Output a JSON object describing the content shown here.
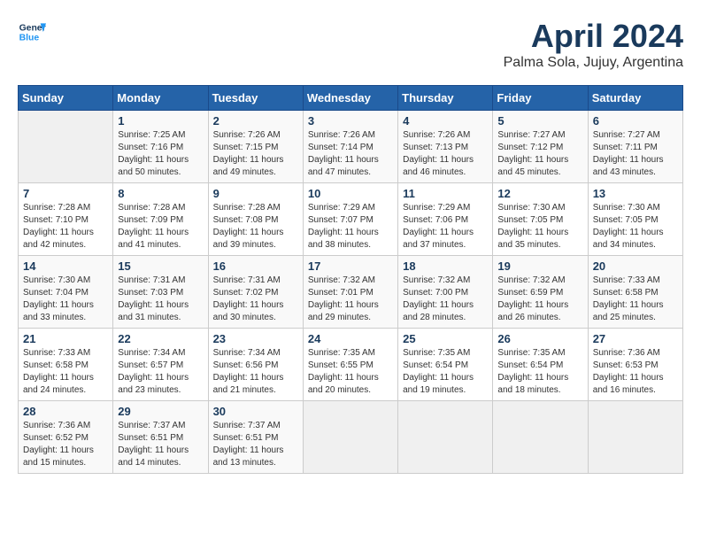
{
  "header": {
    "logo_line1": "General",
    "logo_line2": "Blue",
    "month": "April 2024",
    "location": "Palma Sola, Jujuy, Argentina"
  },
  "days_of_week": [
    "Sunday",
    "Monday",
    "Tuesday",
    "Wednesday",
    "Thursday",
    "Friday",
    "Saturday"
  ],
  "weeks": [
    [
      {
        "day": "",
        "info": ""
      },
      {
        "day": "1",
        "info": "Sunrise: 7:25 AM\nSunset: 7:16 PM\nDaylight: 11 hours\nand 50 minutes."
      },
      {
        "day": "2",
        "info": "Sunrise: 7:26 AM\nSunset: 7:15 PM\nDaylight: 11 hours\nand 49 minutes."
      },
      {
        "day": "3",
        "info": "Sunrise: 7:26 AM\nSunset: 7:14 PM\nDaylight: 11 hours\nand 47 minutes."
      },
      {
        "day": "4",
        "info": "Sunrise: 7:26 AM\nSunset: 7:13 PM\nDaylight: 11 hours\nand 46 minutes."
      },
      {
        "day": "5",
        "info": "Sunrise: 7:27 AM\nSunset: 7:12 PM\nDaylight: 11 hours\nand 45 minutes."
      },
      {
        "day": "6",
        "info": "Sunrise: 7:27 AM\nSunset: 7:11 PM\nDaylight: 11 hours\nand 43 minutes."
      }
    ],
    [
      {
        "day": "7",
        "info": "Sunrise: 7:28 AM\nSunset: 7:10 PM\nDaylight: 11 hours\nand 42 minutes."
      },
      {
        "day": "8",
        "info": "Sunrise: 7:28 AM\nSunset: 7:09 PM\nDaylight: 11 hours\nand 41 minutes."
      },
      {
        "day": "9",
        "info": "Sunrise: 7:28 AM\nSunset: 7:08 PM\nDaylight: 11 hours\nand 39 minutes."
      },
      {
        "day": "10",
        "info": "Sunrise: 7:29 AM\nSunset: 7:07 PM\nDaylight: 11 hours\nand 38 minutes."
      },
      {
        "day": "11",
        "info": "Sunrise: 7:29 AM\nSunset: 7:06 PM\nDaylight: 11 hours\nand 37 minutes."
      },
      {
        "day": "12",
        "info": "Sunrise: 7:30 AM\nSunset: 7:05 PM\nDaylight: 11 hours\nand 35 minutes."
      },
      {
        "day": "13",
        "info": "Sunrise: 7:30 AM\nSunset: 7:05 PM\nDaylight: 11 hours\nand 34 minutes."
      }
    ],
    [
      {
        "day": "14",
        "info": "Sunrise: 7:30 AM\nSunset: 7:04 PM\nDaylight: 11 hours\nand 33 minutes."
      },
      {
        "day": "15",
        "info": "Sunrise: 7:31 AM\nSunset: 7:03 PM\nDaylight: 11 hours\nand 31 minutes."
      },
      {
        "day": "16",
        "info": "Sunrise: 7:31 AM\nSunset: 7:02 PM\nDaylight: 11 hours\nand 30 minutes."
      },
      {
        "day": "17",
        "info": "Sunrise: 7:32 AM\nSunset: 7:01 PM\nDaylight: 11 hours\nand 29 minutes."
      },
      {
        "day": "18",
        "info": "Sunrise: 7:32 AM\nSunset: 7:00 PM\nDaylight: 11 hours\nand 28 minutes."
      },
      {
        "day": "19",
        "info": "Sunrise: 7:32 AM\nSunset: 6:59 PM\nDaylight: 11 hours\nand 26 minutes."
      },
      {
        "day": "20",
        "info": "Sunrise: 7:33 AM\nSunset: 6:58 PM\nDaylight: 11 hours\nand 25 minutes."
      }
    ],
    [
      {
        "day": "21",
        "info": "Sunrise: 7:33 AM\nSunset: 6:58 PM\nDaylight: 11 hours\nand 24 minutes."
      },
      {
        "day": "22",
        "info": "Sunrise: 7:34 AM\nSunset: 6:57 PM\nDaylight: 11 hours\nand 23 minutes."
      },
      {
        "day": "23",
        "info": "Sunrise: 7:34 AM\nSunset: 6:56 PM\nDaylight: 11 hours\nand 21 minutes."
      },
      {
        "day": "24",
        "info": "Sunrise: 7:35 AM\nSunset: 6:55 PM\nDaylight: 11 hours\nand 20 minutes."
      },
      {
        "day": "25",
        "info": "Sunrise: 7:35 AM\nSunset: 6:54 PM\nDaylight: 11 hours\nand 19 minutes."
      },
      {
        "day": "26",
        "info": "Sunrise: 7:35 AM\nSunset: 6:54 PM\nDaylight: 11 hours\nand 18 minutes."
      },
      {
        "day": "27",
        "info": "Sunrise: 7:36 AM\nSunset: 6:53 PM\nDaylight: 11 hours\nand 16 minutes."
      }
    ],
    [
      {
        "day": "28",
        "info": "Sunrise: 7:36 AM\nSunset: 6:52 PM\nDaylight: 11 hours\nand 15 minutes."
      },
      {
        "day": "29",
        "info": "Sunrise: 7:37 AM\nSunset: 6:51 PM\nDaylight: 11 hours\nand 14 minutes."
      },
      {
        "day": "30",
        "info": "Sunrise: 7:37 AM\nSunset: 6:51 PM\nDaylight: 11 hours\nand 13 minutes."
      },
      {
        "day": "",
        "info": ""
      },
      {
        "day": "",
        "info": ""
      },
      {
        "day": "",
        "info": ""
      },
      {
        "day": "",
        "info": ""
      }
    ]
  ]
}
